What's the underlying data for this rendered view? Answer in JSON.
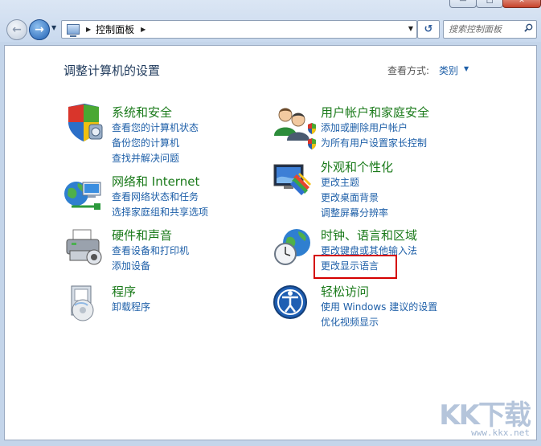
{
  "window": {
    "minimize_glyph": "—",
    "maximize_glyph": "□",
    "close_glyph": "✕"
  },
  "nav": {
    "back_glyph": "←",
    "forward_glyph": "→",
    "recent_glyph": "▼"
  },
  "address": {
    "breadcrumb": "控制面板",
    "separator": "▶",
    "dropdown_glyph": "▼"
  },
  "refresh_glyph": "↺",
  "search": {
    "placeholder": "搜索控制面板"
  },
  "main": {
    "title": "调整计算机的设置",
    "view_by_label": "查看方式:",
    "view_by_value": "类别",
    "view_by_caret": "▼"
  },
  "categories": [
    {
      "heading": "系统和安全",
      "links": [
        "查看您的计算机状态",
        "备份您的计算机",
        "查找并解决问题"
      ]
    },
    {
      "heading": "网络和 Internet",
      "links": [
        "查看网络状态和任务",
        "选择家庭组和共享选项"
      ]
    },
    {
      "heading": "硬件和声音",
      "links": [
        "查看设备和打印机",
        "添加设备"
      ]
    },
    {
      "heading": "程序",
      "links": [
        "卸载程序"
      ]
    },
    {
      "heading": "用户帐户和家庭安全",
      "links": [
        "添加或删除用户帐户",
        "为所有用户设置家长控制"
      ]
    },
    {
      "heading": "外观和个性化",
      "links": [
        "更改主题",
        "更改桌面背景",
        "调整屏幕分辨率"
      ]
    },
    {
      "heading": "时钟、语言和区域",
      "links": [
        "更改键盘或其他输入法",
        "更改显示语言"
      ]
    },
    {
      "heading": "轻松访问",
      "links": [
        "使用 Windows 建议的设置",
        "优化视频显示"
      ]
    }
  ],
  "watermark": {
    "main": "KK下载",
    "sub": "www.kkx.net"
  },
  "colors": {
    "heading_green": "#1a7a1a",
    "link_blue": "#1e5fa8",
    "highlight_red": "#d40000",
    "chrome_blue": "#c4d5ea"
  }
}
